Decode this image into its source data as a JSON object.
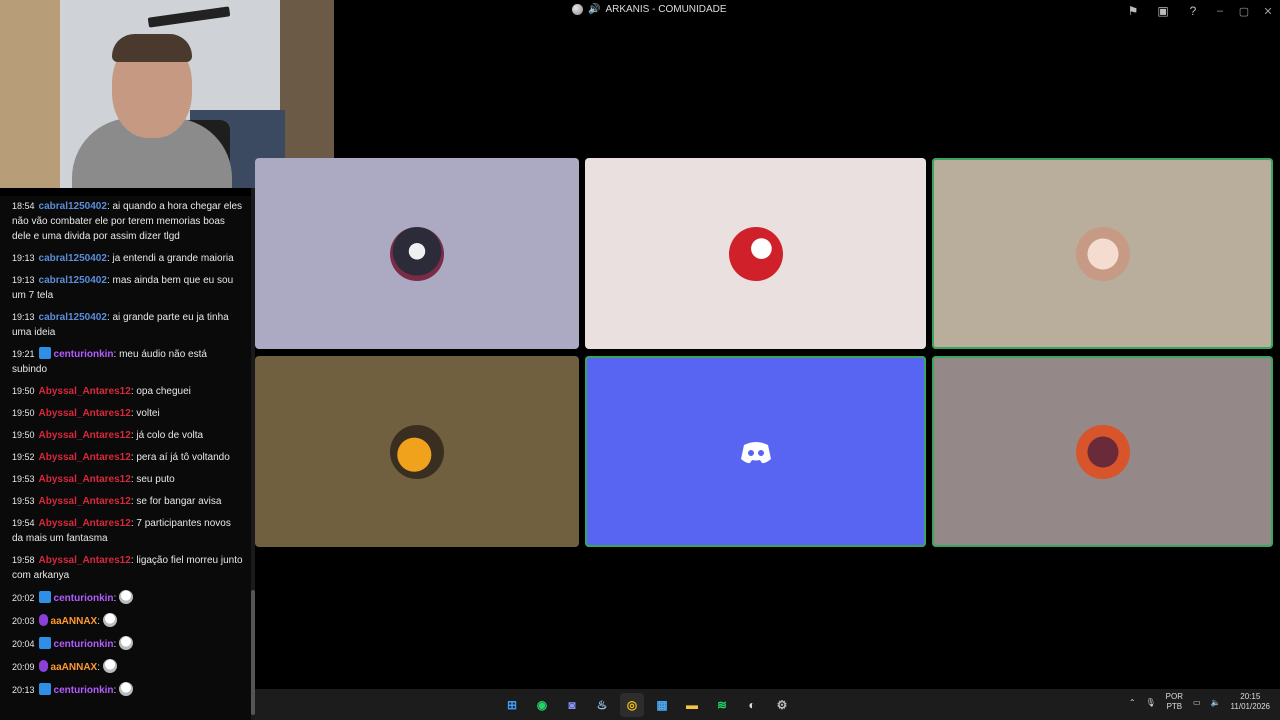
{
  "window": {
    "title": "ARKANIS - COMUNIDADE",
    "icons": [
      "flag-icon",
      "picture-in-picture-icon",
      "help-icon",
      "minimize-icon",
      "maximize-icon",
      "close-icon"
    ]
  },
  "chat": {
    "messages": [
      {
        "time": "18:54",
        "user": "cabral1250402",
        "color": "#5a8ed8",
        "badge": "",
        "text": ": ai quando a hora chegar eles não vão combater ele por terem memorias boas dele e uma divida por assim dizer tlgd"
      },
      {
        "time": "19:13",
        "user": "cabral1250402",
        "color": "#5a8ed8",
        "badge": "",
        "text": ": ja entendi a grande maioria"
      },
      {
        "time": "19:13",
        "user": "cabral1250402",
        "color": "#5a8ed8",
        "badge": "",
        "text": ": mas ainda bem que eu sou um 7 tela"
      },
      {
        "time": "19:13",
        "user": "cabral1250402",
        "color": "#5a8ed8",
        "badge": "",
        "text": ": ai grande parte eu ja tinha uma ideia"
      },
      {
        "time": "19:21",
        "user": "centurionkin",
        "color": "#b35cff",
        "badge": "blue",
        "text": ": meu áudio não está subindo"
      },
      {
        "time": "19:50",
        "user": "Abyssal_Antares12",
        "color": "#d8283a",
        "badge": "",
        "text": ": opa cheguei"
      },
      {
        "time": "19:50",
        "user": "Abyssal_Antares12",
        "color": "#d8283a",
        "badge": "",
        "text": ": voltei"
      },
      {
        "time": "19:50",
        "user": "Abyssal_Antares12",
        "color": "#d8283a",
        "badge": "",
        "text": ": já colo de volta"
      },
      {
        "time": "19:52",
        "user": "Abyssal_Antares12",
        "color": "#d8283a",
        "badge": "",
        "text": ": pera aí já tô voltando"
      },
      {
        "time": "19:53",
        "user": "Abyssal_Antares12",
        "color": "#d8283a",
        "badge": "",
        "text": ": seu puto"
      },
      {
        "time": "19:53",
        "user": "Abyssal_Antares12",
        "color": "#d8283a",
        "badge": "",
        "text": ": se for bangar avisa"
      },
      {
        "time": "19:54",
        "user": "Abyssal_Antares12",
        "color": "#d8283a",
        "badge": "",
        "text": ": 7 participantes novos da mais um fantasma"
      },
      {
        "time": "19:58",
        "user": "Abyssal_Antares12",
        "color": "#d8283a",
        "badge": "",
        "text": ": ligação fiel morreu junto com arkanya"
      },
      {
        "time": "20:02",
        "user": "centurionkin",
        "color": "#b35cff",
        "badge": "blue",
        "text": ":",
        "emote": true
      },
      {
        "time": "20:03",
        "user": "aaANNAX",
        "color": "#ff9a2e",
        "badge": "purple",
        "text": ":",
        "emote": true
      },
      {
        "time": "20:04",
        "user": "centurionkin",
        "color": "#b35cff",
        "badge": "blue",
        "text": ":",
        "emote": true
      },
      {
        "time": "20:09",
        "user": "aaANNAX",
        "color": "#ff9a2e",
        "badge": "purple",
        "text": ":",
        "emote": true
      },
      {
        "time": "20:13",
        "user": "centurionkin",
        "color": "#b35cff",
        "badge": "blue",
        "text": ":",
        "emote": true
      }
    ]
  },
  "participants": [
    {
      "bg": "#abaac2",
      "avatar": "skull-character-avatar",
      "speaking": false
    },
    {
      "bg": "#ebe0e0",
      "avatar": "scorpion-logo-avatar",
      "speaking": false
    },
    {
      "bg": "#b9ae9b",
      "avatar": "cowboy-character-avatar",
      "speaking": true
    },
    {
      "bg": "#70603f",
      "avatar": "duck-character-avatar",
      "speaking": false
    },
    {
      "bg": "#5865f2",
      "avatar": "discord-logo-avatar",
      "speaking": true
    },
    {
      "bg": "#958889",
      "avatar": "anime-character-avatar",
      "speaking": true
    }
  ],
  "taskbar": {
    "apps": [
      "windows-start-icon",
      "whatsapp-icon",
      "discord-icon",
      "steam-icon",
      "chrome-icon",
      "photos-icon",
      "file-explorer-icon",
      "spotify-icon",
      "obs-icon",
      "settings-icon"
    ],
    "lang_line1": "POR",
    "lang_line2": "PTB",
    "time": "20:15",
    "date": "11/01/2026"
  }
}
